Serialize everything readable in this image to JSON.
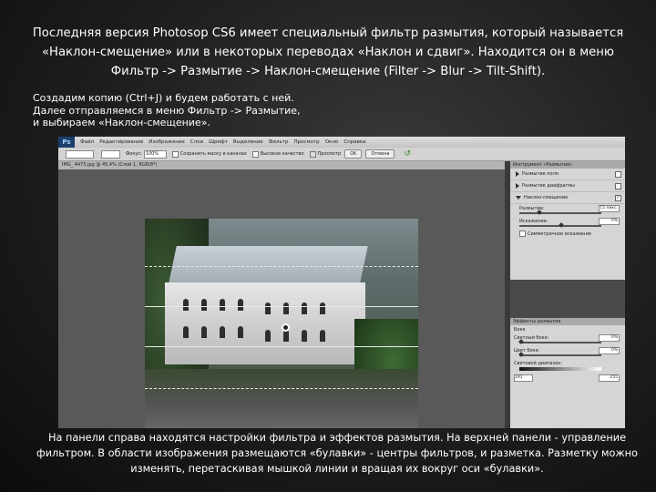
{
  "slide": {
    "title": "Последняя версия Photosop CS6 имеет специальный фильтр размытия, который называется «Наклон-смещение» или в некоторых переводах «Наклон и сдвиг». Находится он в меню Фильтр -> Размытие -> Наклон-смещение (Filter -> Blur -> Tilt-Shift).",
    "intro_lines": [
      "Создадим копию (Ctrl+J) и будем работать с ней.",
      "Далее отправляемся в меню Фильтр -> Размытие,",
      "и выбираем «Наклон-смещение»."
    ],
    "bottom_text": "На панели справа находятся настройки фильтра и эффектов размытия. На верхней панели - управление фильтром. В области изображения размещаются «булавки» - центры фильтров, и разметка. Разметку можно изменять, перетаскивая мышкой линии и вращая их вокруг оси «булавки»."
  },
  "photoshop": {
    "logo": "Ps",
    "menu": [
      "Файл",
      "Редактирование",
      "Изображение",
      "Слои",
      "Шрифт",
      "Выделение",
      "Фильтр",
      "Просмотр",
      "Окно",
      "Справка"
    ],
    "options": {
      "focus_label": "Фокус:",
      "focus_value": "100%",
      "save_mask_label": "Сохранить маску в каналах",
      "high_quality_label": "Высокое качество",
      "preview_label": "Просмотр",
      "ok_label": "OK",
      "cancel_label": "Отмена"
    },
    "document_tab": "IMG_ 4473.jpg @ 45,4% (Слой 1, RGB/8*)",
    "blur_tools": {
      "header": "Инструмент «Размытие»",
      "items": [
        {
          "label": "Размытие поля",
          "checked": false,
          "expanded": false
        },
        {
          "label": "Размытие диафрагмы",
          "checked": false,
          "expanded": false
        },
        {
          "label": "Наклон-смещение",
          "checked": true,
          "expanded": true
        }
      ],
      "blur_label": "Размытие:",
      "blur_value": "15 пикс.",
      "distortion_label": "Искажение:",
      "distortion_value": "0%",
      "symmetric_label": "Симметричное искажение"
    },
    "effects": {
      "header": "Эффекты размытия",
      "bokeh_label": "Боке",
      "light_bokeh_label": "Светлый боке:",
      "light_bokeh_value": "0%",
      "color_bokeh_label": "Цвет боке:",
      "color_bokeh_value": "0%",
      "light_range_label": "Световой диапазон:",
      "range_low": "191",
      "range_high": "255"
    }
  }
}
